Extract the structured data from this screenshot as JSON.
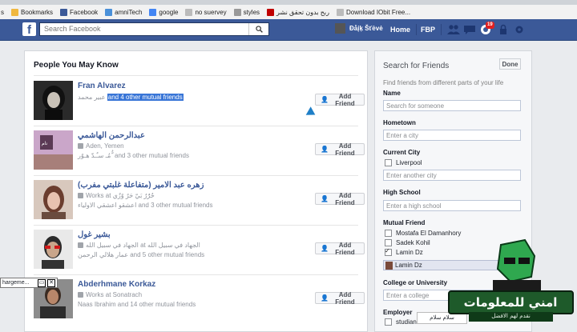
{
  "bookmarks": [
    {
      "label": "Bookmarks",
      "color": "#f0b840"
    },
    {
      "label": "Facebook",
      "color": "#3b5998"
    },
    {
      "label": "amniTech",
      "color": "#4a90d9"
    },
    {
      "label": "google",
      "color": "#4285f4"
    },
    {
      "label": "no suervey",
      "color": "#bbbbbb"
    },
    {
      "label": "styles",
      "color": "#999999"
    },
    {
      "label": "ربح بدون تحقق نشر",
      "color": "#c00000"
    },
    {
      "label": "Download IObit Free...",
      "color": "#bbbbbb"
    }
  ],
  "bookmarks_lead": "s",
  "header": {
    "search_placeholder": "Search Facebook",
    "user_name": "Ðåįķ Šťėvė",
    "home_label": "Home",
    "fbp_label": "FBP",
    "notification_count": "19"
  },
  "main": {
    "title": "People You May Know",
    "people": [
      {
        "name": "Fran Alvarez",
        "line1_arabic": "عبير محمد",
        "line1_highlight": "and 4 other mutual friends",
        "button": "Add Friend"
      },
      {
        "name": "عبدالرحمن الهاشمي",
        "line1": "Aden, Yemen",
        "line2": "مُـ سـٌـدّ هـوٌر ٌّ and 3 other mutual friends",
        "button": "Add Friend"
      },
      {
        "name": "(متفاعلة غلبتي مفرب) زهره عبد الامير",
        "line1": "Works at حٌرٌٌرٌ بَيّ حَرٌ وٌزٌي",
        "line2": "اعشقو اعشقي الاولياء and 3 other mutual friends",
        "button": "Add Friend"
      },
      {
        "name": "بشير غول",
        "line1": "الجهاد في سبيل الله at الجهاد في سبيل الله",
        "line2": "عمار هلالي الرحمن and 5 other mutual friends",
        "button": "Add Friend"
      },
      {
        "name": "Abderhmane Korkaz",
        "line1": "Works at Sonatrach",
        "line2": "Naas Ibrahim and 14 other mutual friends",
        "button": "Add Friend"
      }
    ]
  },
  "side": {
    "title": "Search for Friends",
    "done": "Done",
    "subtitle": "Find friends from different parts of your life",
    "name_label": "Name",
    "name_placeholder": "Search for someone",
    "hometown_label": "Hometown",
    "hometown_placeholder": "Enter a city",
    "current_city_label": "Current City",
    "current_city_option": "Liverpool",
    "current_city_placeholder": "Enter another city",
    "high_school_label": "High School",
    "high_school_placeholder": "Enter a high school",
    "mutual_label": "Mutual Friend",
    "mutual_options": [
      {
        "label": "Mostafa El Damanhory",
        "checked": false
      },
      {
        "label": "Sadek Kohil",
        "checked": false
      },
      {
        "label": "Lamin Dz",
        "checked": true
      }
    ],
    "mutual_token": "Lamin Dz",
    "college_label": "College or University",
    "college_placeholder": "Enter a college",
    "employer_label": "Employer",
    "employer_option": "studian"
  },
  "taskbar_tab": "hargeme...",
  "chat_text": "سلام سلام",
  "watermark": {
    "main": "امني للمعلومات",
    "sub": "نقدم لهم الافضل"
  }
}
